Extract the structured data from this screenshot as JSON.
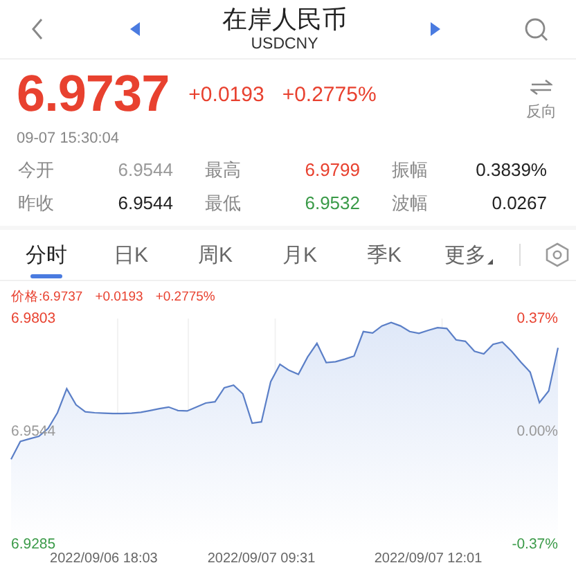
{
  "header": {
    "title": "在岸人民币",
    "subtitle": "USDCNY"
  },
  "quote": {
    "price": "6.9737",
    "change": "+0.0193",
    "percent": "+0.2775%",
    "time": "09-07 15:30:04",
    "reverse_label": "反向"
  },
  "stats": [
    {
      "cells": [
        {
          "label": "今开",
          "value": "6.9544",
          "color": "#999999"
        },
        {
          "label": "最高",
          "value": "6.9799",
          "color": "#e8412f"
        },
        {
          "label": "振幅",
          "value": "0.3839%",
          "color": "#222222"
        }
      ]
    },
    {
      "cells": [
        {
          "label": "昨收",
          "value": "6.9544",
          "color": "#222222"
        },
        {
          "label": "最低",
          "value": "6.9532",
          "color": "#3a9a48"
        },
        {
          "label": "波幅",
          "value": "0.0267",
          "color": "#222222"
        }
      ]
    }
  ],
  "tabs": [
    {
      "label": "分时",
      "selected": true,
      "kind": "period"
    },
    {
      "label": "日K",
      "selected": false,
      "kind": "period"
    },
    {
      "label": "周K",
      "selected": false,
      "kind": "period"
    },
    {
      "label": "月K",
      "selected": false,
      "kind": "period"
    },
    {
      "label": "季K",
      "selected": false,
      "kind": "period"
    },
    {
      "label": "更多",
      "selected": false,
      "kind": "menu"
    }
  ],
  "chart": {
    "legend": {
      "price": "价格:6.9737",
      "change": "+0.0193",
      "percent": "+0.2775%"
    },
    "percent_axis": [
      {
        "label": "0.37%",
        "color": "#e8412f"
      },
      {
        "label": "0.00%",
        "color": "#999999"
      },
      {
        "label": "-0.37%",
        "color": "#3a9a48"
      }
    ],
    "chart_data": {
      "type": "area",
      "categories": [
        null,
        null,
        null,
        null,
        null,
        null,
        null,
        null,
        null,
        null,
        "2022/09/06 18:03",
        null,
        null,
        null,
        null,
        null,
        null,
        null,
        null,
        null,
        null,
        null,
        null,
        null,
        null,
        null,
        null,
        "2022/09/07 09:31",
        null,
        null,
        null,
        null,
        null,
        null,
        null,
        null,
        null,
        null,
        null,
        null,
        null,
        null,
        null,
        null,
        null,
        "2022/09/07 12:01",
        null,
        null,
        null,
        null,
        null,
        null,
        null,
        null,
        null,
        null,
        null,
        null,
        null,
        null
      ],
      "series": [
        {
          "color": "#5b7fc7",
          "values": [
            6.948,
            6.9521,
            6.9527,
            6.9533,
            6.9551,
            6.9587,
            6.9642,
            6.9605,
            6.9589,
            6.9587,
            6.9586,
            6.9585,
            6.9585,
            6.9586,
            6.9588,
            6.9592,
            6.9596,
            6.96,
            6.9592,
            6.9591,
            6.96,
            6.9609,
            6.9612,
            6.9644,
            6.965,
            6.963,
            6.9563,
            6.9566,
            6.9658,
            6.9698,
            6.9684,
            6.9675,
            6.9715,
            6.9746,
            6.9702,
            6.9704,
            6.971,
            6.9717,
            6.9773,
            6.977,
            6.9786,
            6.9794,
            6.9786,
            6.9773,
            6.9769,
            6.9776,
            6.9782,
            6.978,
            6.9754,
            6.9751,
            6.9728,
            6.9722,
            6.9744,
            6.9749,
            6.9728,
            6.9703,
            6.968,
            6.961,
            6.9637,
            6.9736
          ]
        }
      ],
      "ylim": [
        6.9285,
        6.9803
      ],
      "yticks": [
        {
          "value": 6.9285,
          "label": "6.9285"
        },
        {
          "value": 6.9544,
          "label": "6.9544"
        },
        {
          "value": 6.9803,
          "label": "6.9803"
        }
      ]
    }
  }
}
